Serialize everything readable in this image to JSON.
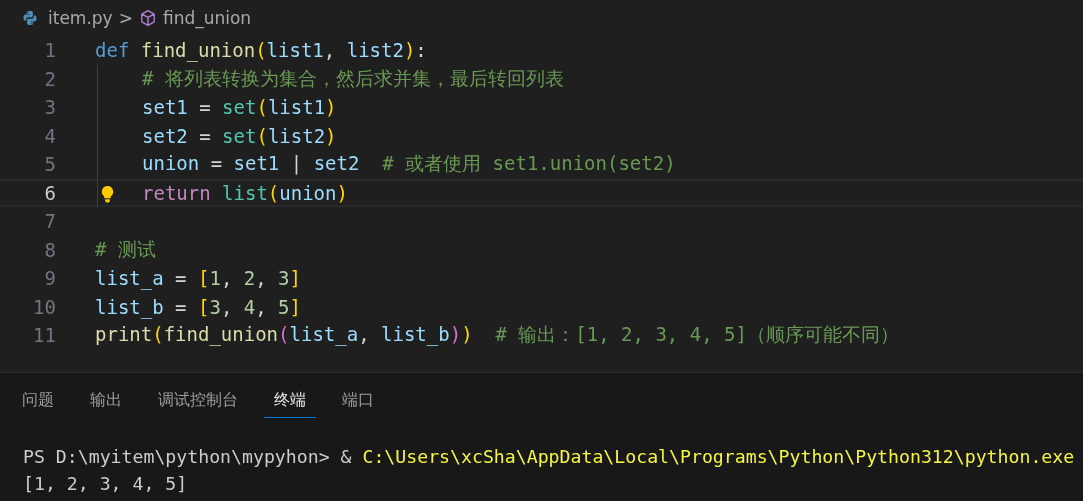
{
  "breadcrumb": {
    "file": "item.py",
    "separator": ">",
    "symbol": "find_union"
  },
  "code_lines": [
    {
      "number": "1",
      "current": false,
      "tokens": [
        {
          "text": "def ",
          "kind": "keyword"
        },
        {
          "text": "find_union",
          "kind": "function"
        },
        {
          "text": "(",
          "kind": "bracket1"
        },
        {
          "text": "list1",
          "kind": "variable"
        },
        {
          "text": ", ",
          "kind": "plain"
        },
        {
          "text": "list2",
          "kind": "variable"
        },
        {
          "text": ")",
          "kind": "bracket1"
        },
        {
          "text": ":",
          "kind": "plain"
        }
      ],
      "children": [
        {
          "number": "2",
          "current": false,
          "tokens": [
            {
              "text": "# 将列表转换为集合，然后求并集，最后转回列表",
              "kind": "comment"
            }
          ]
        },
        {
          "number": "3",
          "current": false,
          "tokens": [
            {
              "text": "set1",
              "kind": "variable"
            },
            {
              "text": " = ",
              "kind": "plain"
            },
            {
              "text": "set",
              "kind": "builtin"
            },
            {
              "text": "(",
              "kind": "bracket1"
            },
            {
              "text": "list1",
              "kind": "variable"
            },
            {
              "text": ")",
              "kind": "bracket1"
            }
          ]
        },
        {
          "number": "4",
          "current": false,
          "tokens": [
            {
              "text": "set2",
              "kind": "variable"
            },
            {
              "text": " = ",
              "kind": "plain"
            },
            {
              "text": "set",
              "kind": "builtin"
            },
            {
              "text": "(",
              "kind": "bracket1"
            },
            {
              "text": "list2",
              "kind": "variable"
            },
            {
              "text": ")",
              "kind": "bracket1"
            }
          ]
        },
        {
          "number": "5",
          "current": false,
          "tokens": [
            {
              "text": "union",
              "kind": "variable"
            },
            {
              "text": " = ",
              "kind": "plain"
            },
            {
              "text": "set1",
              "kind": "variable"
            },
            {
              "text": " | ",
              "kind": "plain"
            },
            {
              "text": "set2  ",
              "kind": "variable"
            },
            {
              "text": "# 或者使用 set1.union(set2)",
              "kind": "comment"
            }
          ]
        },
        {
          "number": "6",
          "current": true,
          "tokens": [
            {
              "text": "return ",
              "kind": "control"
            },
            {
              "text": "list",
              "kind": "builtin"
            },
            {
              "text": "(",
              "kind": "bracket1"
            },
            {
              "text": "union",
              "kind": "variable"
            },
            {
              "text": ")",
              "kind": "bracket1"
            }
          ]
        }
      ]
    },
    {
      "number": "7",
      "current": false
    },
    {
      "number": "8",
      "current": false,
      "tokens": [
        {
          "text": "# 测试",
          "kind": "comment"
        }
      ]
    },
    {
      "number": "9",
      "current": false,
      "tokens": [
        {
          "text": "list_a",
          "kind": "variable"
        },
        {
          "text": " = ",
          "kind": "plain"
        },
        {
          "text": "[",
          "kind": "bracket1"
        },
        {
          "text": "1",
          "kind": "number"
        },
        {
          "text": ", ",
          "kind": "plain"
        },
        {
          "text": "2",
          "kind": "number"
        },
        {
          "text": ", ",
          "kind": "plain"
        },
        {
          "text": "3",
          "kind": "number"
        },
        {
          "text": "]",
          "kind": "bracket1"
        }
      ]
    },
    {
      "number": "10",
      "current": false,
      "tokens": [
        {
          "text": "list_b",
          "kind": "variable"
        },
        {
          "text": " = ",
          "kind": "plain"
        },
        {
          "text": "[",
          "kind": "bracket1"
        },
        {
          "text": "3",
          "kind": "number"
        },
        {
          "text": ", ",
          "kind": "plain"
        },
        {
          "text": "4",
          "kind": "number"
        },
        {
          "text": ", ",
          "kind": "plain"
        },
        {
          "text": "5",
          "kind": "number"
        },
        {
          "text": "]",
          "kind": "bracket1"
        }
      ]
    },
    {
      "number": "11",
      "current": false,
      "tokens": [
        {
          "text": "print",
          "kind": "function"
        },
        {
          "text": "(",
          "kind": "bracket1"
        },
        {
          "text": "find_union",
          "kind": "function"
        },
        {
          "text": "(",
          "kind": "bracket2"
        },
        {
          "text": "list_a",
          "kind": "variable"
        },
        {
          "text": ", ",
          "kind": "plain"
        },
        {
          "text": "list_b",
          "kind": "variable"
        },
        {
          "text": ")",
          "kind": "bracket2"
        },
        {
          "text": ")  ",
          "kind": "bracket1"
        },
        {
          "text": "# 输出：[1, 2, 3, 4, 5]（顺序可能不同）",
          "kind": "comment"
        }
      ]
    }
  ],
  "panel_tabs": [
    {
      "label": "问题",
      "selected": false
    },
    {
      "label": "输出",
      "selected": false
    },
    {
      "label": "调试控制台",
      "selected": false
    },
    {
      "label": "终端",
      "selected": true
    },
    {
      "label": "端口",
      "selected": false
    }
  ],
  "terminal_lines": [
    {
      "tokens": [
        {
          "text": "PS D:\\myitem\\python\\mypyhon> & ",
          "kind": "plain"
        },
        {
          "text": "C:\\Users\\xcSha\\AppData\\Local\\Programs\\Python\\Python312\\python.exe",
          "kind": "path"
        }
      ]
    },
    {
      "tokens": [
        {
          "text": "[1, 2, 3, 4, 5]",
          "kind": "plain"
        }
      ]
    }
  ]
}
